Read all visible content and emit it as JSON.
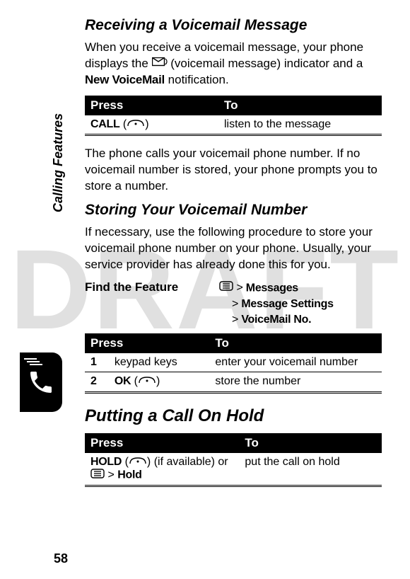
{
  "watermark": "DRAFT",
  "sideLabel": "Calling Features",
  "pageNumber": "58",
  "section1": {
    "heading": "Receiving a Voicemail Message",
    "para1_a": "When you receive a voicemail message, your phone displays the ",
    "para1_b": " (voicemail message) indicator and a ",
    "para1_bold": "New VoiceMail",
    "para1_c": " notification.",
    "table": {
      "h1": "Press",
      "h2": "To",
      "r1_key": "CALL",
      "r1_paren_open": " (",
      "r1_paren_close": ")",
      "r1_to": "listen to the message"
    },
    "para2": "The phone calls your voicemail phone number. If no voicemail number is stored, your phone prompts you to store a number."
  },
  "section2": {
    "heading": "Storing Your Voicemail Number",
    "para": "If necessary, use the following procedure to store your voicemail phone number on your phone. Usually, your service provider has already done this for you.",
    "featureLabel": "Find the Feature",
    "path": {
      "l1_gt": ">",
      "l1": "Messages",
      "l2_gt": ">",
      "l2": "Message Settings",
      "l3_gt": ">",
      "l3": "VoiceMail No."
    },
    "table": {
      "h1": "Press",
      "h2": "To",
      "r1_num": "1",
      "r1_key": "keypad keys",
      "r1_to": "enter your voicemail number",
      "r2_num": "2",
      "r2_key": "OK",
      "r2_paren_open": " (",
      "r2_paren_close": ")",
      "r2_to": "store the number"
    }
  },
  "section3": {
    "heading": "Putting a Call On Hold",
    "table": {
      "h1": "Press",
      "h2": "To",
      "r1_key": "HOLD",
      "r1_paren_open": " (",
      "r1_paren_close": ") (if available) or ",
      "r1_gt": " > ",
      "r1_hold2": "Hold",
      "r1_to": "put the call on hold"
    }
  }
}
